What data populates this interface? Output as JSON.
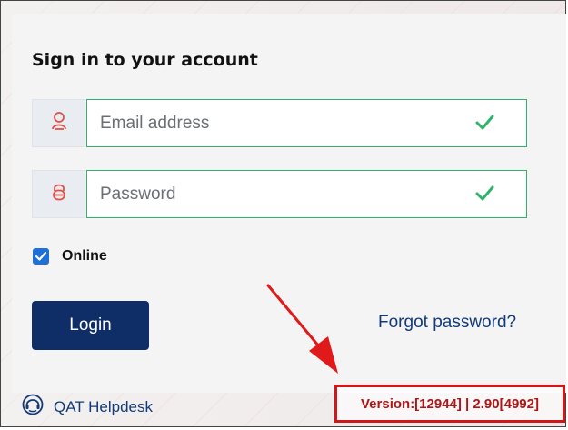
{
  "form": {
    "title": "Sign in to your account",
    "email_placeholder": "Email address",
    "password_placeholder": "Password",
    "online_label": "Online",
    "online_checked": true,
    "login_label": "Login",
    "forgot_label": "Forgot password?"
  },
  "footer": {
    "helpdesk_label": "QAT Helpdesk",
    "version_text": "Version:[12944] | 2.90[4992]"
  },
  "colors": {
    "primary": "#0f2d66",
    "valid": "#2fb36a",
    "annotation": "#d01818",
    "user_icon": "#e0504b"
  },
  "icons": [
    "user-icon",
    "lock-icon",
    "checkmark-icon",
    "headset-icon",
    "annotation-arrow"
  ]
}
